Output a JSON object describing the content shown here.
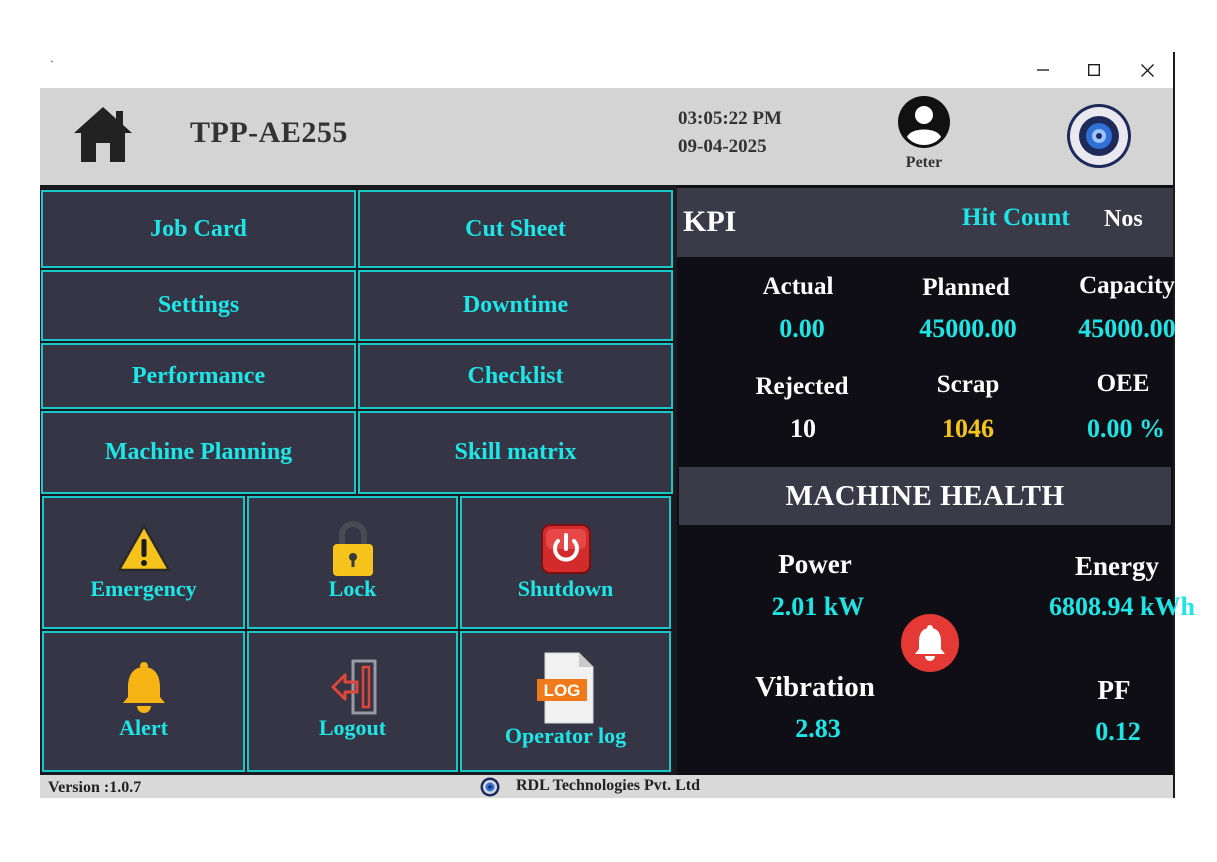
{
  "window": {
    "title_glyph": "`",
    "controls": [
      "minimize",
      "maximize",
      "close"
    ]
  },
  "header": {
    "home_icon": "home-icon",
    "machine_id": "TPP-AE255",
    "time": "03:05:22 PM",
    "date": "09-04-2025",
    "user_icon": "user-avatar-icon",
    "user": "Peter",
    "brand_logo": "rdl-logo"
  },
  "nav": {
    "job_card": "Job Card",
    "cut_sheet": "Cut Sheet",
    "settings": "Settings",
    "downtime": "Downtime",
    "performance": "Performance",
    "checklist": "Checklist",
    "machine_planning": "Machine Planning",
    "skill_matrix": "Skill matrix"
  },
  "tiles": {
    "emergency": "Emergency",
    "lock": "Lock",
    "shutdown": "Shutdown",
    "alert": "Alert",
    "logout": "Logout",
    "operator_log": "Operator log",
    "log_badge": "LOG"
  },
  "kpi": {
    "title": "KPI",
    "hit_count": "Hit Count",
    "unit": "Nos",
    "actual_label": "Actual",
    "actual_value": "0.00",
    "planned_label": "Planned",
    "planned_value": "45000.00",
    "capacity_label": "Capacity",
    "capacity_value": "45000.00",
    "rejected_label": "Rejected",
    "rejected_value": "10",
    "scrap_label": "Scrap",
    "scrap_value": "1046",
    "oee_label": "OEE",
    "oee_value": "0.00 %"
  },
  "health": {
    "title": "MACHINE HEALTH",
    "power_label": "Power",
    "power_value": "2.01 kW",
    "energy_label": "Energy",
    "energy_value": "6808.94 kWh",
    "vibration_label": "Vibration",
    "vibration_value": "2.83",
    "pf_label": "PF",
    "pf_value": "0.12"
  },
  "footer": {
    "version": "Version :1.0.7",
    "company": "RDL Technologies Pvt. Ltd"
  },
  "colors": {
    "accent": "#1ee6e6",
    "tile_bg": "#353545",
    "panel_bg": "#0e0e14",
    "header_bg": "#d4d4d4",
    "scrap_value": "#f5c518",
    "alarm": "#e53935"
  }
}
